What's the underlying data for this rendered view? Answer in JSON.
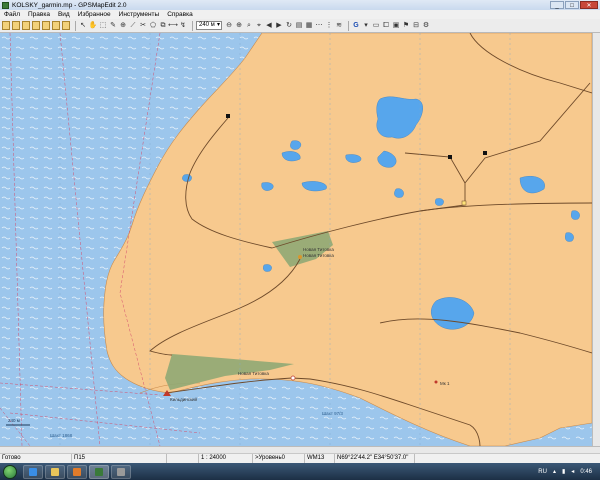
{
  "window": {
    "title": "KOLSKY_garmin.mp - GPSMapEdit 2.0",
    "buttons": [
      "_",
      "□",
      "✕"
    ]
  },
  "menu": [
    "Файл",
    "Правка",
    "Вид",
    "Избранное",
    "Инструменты",
    "Справка"
  ],
  "toolbar": {
    "scale_value": "240 м",
    "letter_g": "G"
  },
  "map": {
    "labels": {
      "settlement_upper": "Новая Титовка",
      "settlement_upper_2": "Новая Титовка",
      "settlement_lower": "Новая Титовка",
      "place_left": "Кильдинский",
      "depth_a": "Шахт 1868",
      "depth_b": "Шахт 97/3",
      "spot": "Мк 1",
      "scale_left": "240 м"
    },
    "colors": {
      "sea": "#9cc6ec",
      "land": "#f7c98e",
      "lake": "#57a6ec",
      "forest": "#8fa874",
      "road": "#6e4a2a"
    }
  },
  "status": {
    "ready": "Готово",
    "layer": "П15",
    "scale": "1 : 24000",
    "level": ">Уровень0",
    "datum": "WM13",
    "coords": "N69°22'44.2\" E34°50'37.0\""
  },
  "taskbar": {
    "lang": "RU",
    "time": "0:46"
  }
}
